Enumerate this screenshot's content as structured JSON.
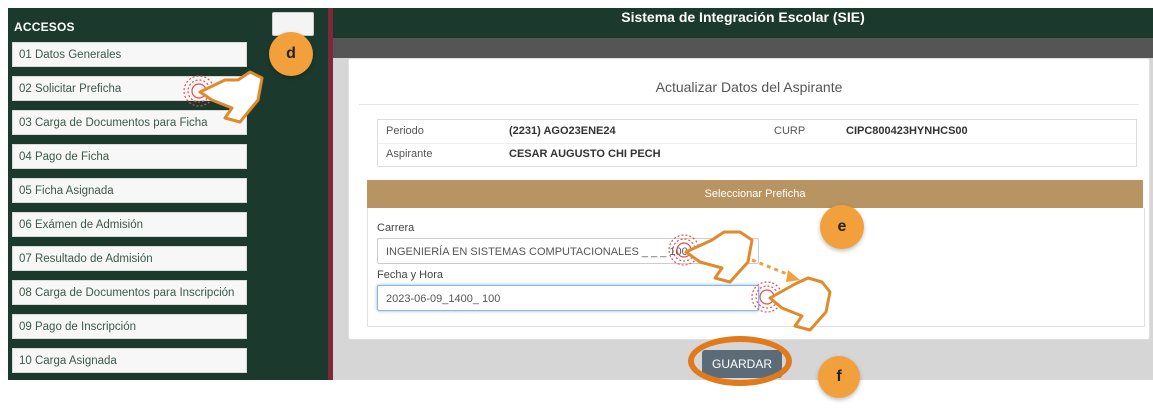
{
  "header": {
    "title": "Sistema de Integración Escolar (SIE)"
  },
  "sidebar": {
    "title": "ACCESOS",
    "items": [
      {
        "label": "01 Datos Generales"
      },
      {
        "label": "02 Solicitar Preficha"
      },
      {
        "label": "03 Carga de Documentos para Ficha"
      },
      {
        "label": "04 Pago de Ficha"
      },
      {
        "label": "05 Ficha Asignada"
      },
      {
        "label": "06 Exámen de Admisión"
      },
      {
        "label": "07 Resultado de Admisión"
      },
      {
        "label": "08 Carga de Documentos para Inscripción"
      },
      {
        "label": "09 Pago de Inscripción"
      },
      {
        "label": "10 Carga Asignada"
      }
    ]
  },
  "panel": {
    "title": "Actualizar Datos del Aspirante",
    "info": {
      "periodo_label": "Periodo",
      "periodo_value": "(2231) AGO23ENE24",
      "curp_label": "CURP",
      "curp_value": "CIPC800423HYNHCS00",
      "aspirante_label": "Aspirante",
      "aspirante_value": "CESAR AUGUSTO CHI PECH"
    },
    "section": {
      "title": "Seleccionar Preficha",
      "carrera_label": "Carrera",
      "carrera_value": "INGENIERÍA EN SISTEMAS COMPUTACIONALES _ _ _ 100",
      "fecha_label": "Fecha y Hora",
      "fecha_value": "2023-06-09_1400_ 100"
    },
    "save_label": "GUARDAR"
  },
  "annotations": {
    "d": "d",
    "e": "e",
    "f": "f"
  },
  "colors": {
    "sidebar_bg": "#1b3a2d",
    "section_header": "#b79462",
    "badge": "#f2a03c",
    "ring": "#e07a1c",
    "button": "#5b6b78"
  }
}
